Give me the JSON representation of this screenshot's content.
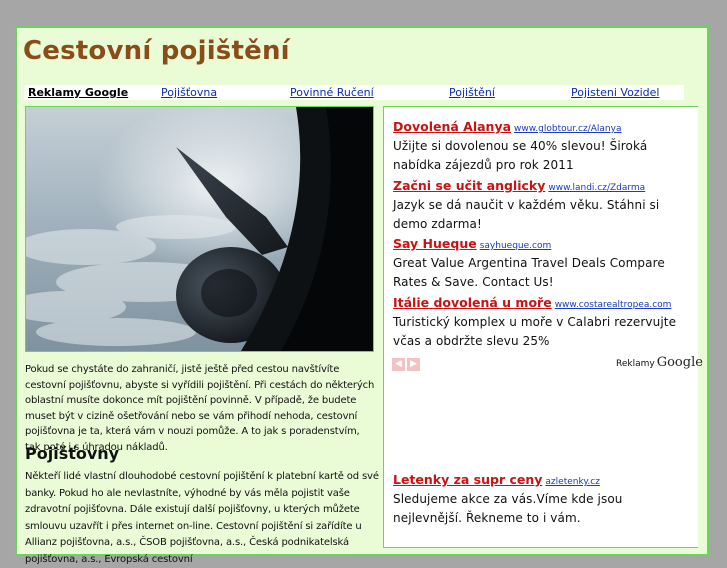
{
  "site": {
    "title": "Cestovní pojištění"
  },
  "linkbar": {
    "header": "Reklamy Google",
    "links": [
      "Pojišťovna",
      "Povinné Ručení",
      "Pojištění",
      "Pojisteni Vozidel"
    ]
  },
  "intro_text": "Pokud se chystáte do zahraničí, jistě ještě před cestou navštívíte cestovní pojišťovnu, abyste si vyřídili pojištění. Při cestách do některých oblastní musíte dokonce mít pojištění povinně. V případě, že budete muset být v cizině ošetřování nebo se vám přihodí nehoda, cestovní pojišťovna je ta, která vám v nouzi pomůže. A to jak s poradenstvím, tak poté i s úhradou nákladů.",
  "section": {
    "heading": "Pojišťovny",
    "text": "Někteří lidé vlastní dlouhodobé cestovní pojištění k platební kartě od své banky. Pokud ho ale nevlastníte, výhodné by vás měla pojistit vaše zdravotní pojišťovna. Dále existují další pojišťovny, u kterých můžete smlouvu uzavřít i přes internet on-line. Cestovní pojištění si zařídíte u Allianz pojišťovna, a.s., ČSOB pojišťovna, a.s., Česká podnikatelská pojišťovna, a.s., Evropská cestovní"
  },
  "ads": [
    {
      "title": "Dovolená Alanya",
      "url": "www.globtour.cz/Alanya",
      "text": "Užijte si dovolenou se 40% slevou! Široká nabídka zájezdů pro rok 2011"
    },
    {
      "title": "Začni se učit anglicky",
      "url": "www.landi.cz/Zdarma",
      "text": "Jazyk se dá naučit v každém věku. Stáhni si demo zdarma!"
    },
    {
      "title": "Say Hueque",
      "url": "sayhueque.com",
      "text": "Great Value Argentina Travel Deals Compare Rates & Save. Contact Us!"
    },
    {
      "title": "Itálie dovolená u moře",
      "url": "www.costarealtropea.com",
      "text": "Turistický komplex u moře v Calabri rezervujte včas a obdržte slevu 25%"
    },
    {
      "title": "Letenky za supr ceny",
      "url": "azletenky.cz",
      "text": "Sledujeme akce za vás.Víme kde jsou nejlevnější. Řekneme to i vám."
    }
  ],
  "adchoices": {
    "label": "Reklamy",
    "brand": "Google"
  },
  "icons": {
    "prev": "chevron-left-icon",
    "next": "chevron-right-icon"
  },
  "colors": {
    "title": "#8a4c19",
    "frame_bg": "#e9fcd6",
    "frame_border": "#6dd25e",
    "ad_title": "#cc1111",
    "link": "#0b2fa8"
  }
}
